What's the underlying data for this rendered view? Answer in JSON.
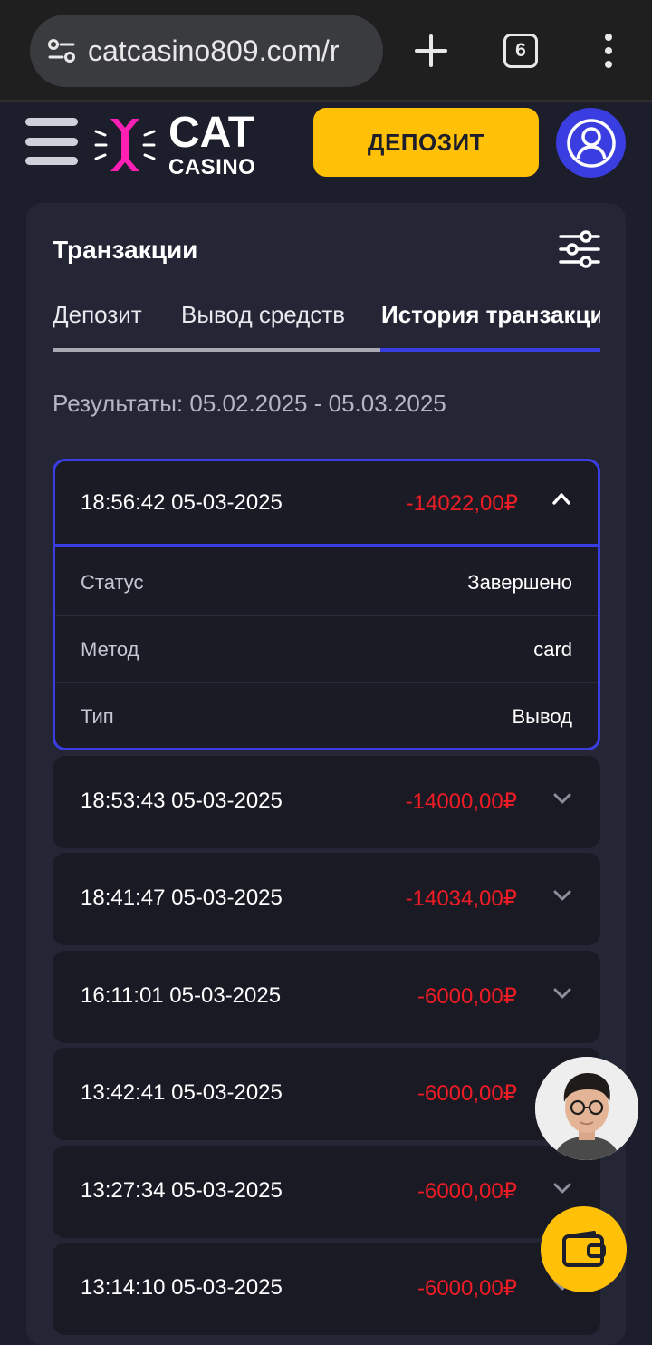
{
  "browser": {
    "url": "catcasino809.com/r",
    "tab_count": "6"
  },
  "header": {
    "logo_main": "CAT",
    "logo_sub": "CASINO",
    "deposit_label": "ДЕПОЗИТ",
    "colors": {
      "accent": "#ffc107",
      "brand": "#3a3ee0",
      "logo_pink": "#ff1fb5"
    }
  },
  "panel": {
    "title": "Транзакции",
    "tabs": [
      {
        "label": "Депозит",
        "active": false
      },
      {
        "label": "Вывод средств",
        "active": false
      },
      {
        "label": "История транзакций",
        "active": true
      }
    ],
    "results_label": "Результаты: 05.02.2025 - 05.03.2025"
  },
  "transactions": [
    {
      "datetime": "18:56:42 05-03-2025",
      "amount": "-14022,00₽",
      "expanded": true,
      "details": [
        {
          "label": "Статус",
          "value": "Завершено"
        },
        {
          "label": "Метод",
          "value": "card"
        },
        {
          "label": "Тип",
          "value": "Вывод"
        }
      ]
    },
    {
      "datetime": "18:53:43 05-03-2025",
      "amount": "-14000,00₽",
      "expanded": false
    },
    {
      "datetime": "18:41:47 05-03-2025",
      "amount": "-14034,00₽",
      "expanded": false
    },
    {
      "datetime": "16:11:01 05-03-2025",
      "amount": "-6000,00₽",
      "expanded": false
    },
    {
      "datetime": "13:42:41 05-03-2025",
      "amount": "-6000,00₽",
      "expanded": false
    },
    {
      "datetime": "13:27:34 05-03-2025",
      "amount": "-6000,00₽",
      "expanded": false
    },
    {
      "datetime": "13:14:10 05-03-2025",
      "amount": "-6000,00₽",
      "expanded": false
    }
  ],
  "icons": {
    "site_info": "site-settings-icon",
    "new_tab": "plus-icon",
    "menu": "hamburger-menu-icon",
    "profile": "user-icon",
    "filter": "sliders-icon",
    "expand": "chevron-down-icon",
    "collapse": "chevron-up-icon",
    "wallet": "wallet-icon"
  }
}
